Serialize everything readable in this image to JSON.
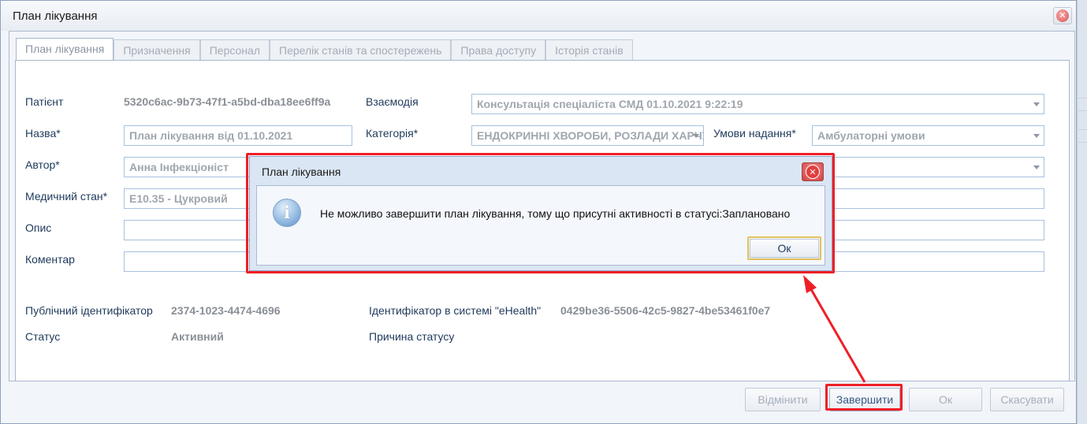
{
  "window": {
    "title": "План лікування"
  },
  "tabs": [
    {
      "label": "План лікування",
      "active": true
    },
    {
      "label": "Призначення",
      "active": false
    },
    {
      "label": "Персонал",
      "active": false
    },
    {
      "label": "Перелік станів та спостережень",
      "active": false
    },
    {
      "label": "Права доступу",
      "active": false
    },
    {
      "label": "Історія станів",
      "active": false
    }
  ],
  "form": {
    "patient_label": "Патієнт",
    "patient_value": "5320c6ac-9b73-47f1-a5bd-dba18ee6ff9a",
    "interaction_label": "Взаємодія",
    "interaction_value": "Консультація спеціаліста СМД 01.10.2021 9:22:19",
    "name_label": "Назва*",
    "name_value": "План лікування від 01.10.2021",
    "category_label": "Категорія*",
    "category_value": "ЕНДОКРИННІ ХВОРОБИ, РОЗЛАДИ ХАРЧУВАННЯ",
    "conditions_label": "Умови надання*",
    "conditions_value": "Амбулаторні умови",
    "author_label": "Автор*",
    "author_value": "Анна Інфекціоніст",
    "condition_label": "Медичний стан*",
    "condition_value": "E10.35 - Цукровий",
    "description_label": "Опис",
    "description_value": "",
    "comment_label": "Коментар",
    "comment_value": "",
    "public_id_label": "Публічний ідентифікатор",
    "public_id_value": "2374-1023-4474-4696",
    "ehealth_id_label": "Ідентифікатор в системі \"eHealth\"",
    "ehealth_id_value": "0429be36-5506-42c5-9827-4be53461f0e7",
    "status_label": "Статус",
    "status_value": "Активний",
    "status_reason_label": "Причина статусу",
    "status_reason_value": ""
  },
  "buttons": {
    "cancel_plan": "Відмінити",
    "complete": "Завершити",
    "ok": "Ок",
    "discard": "Скасувати"
  },
  "dialog": {
    "title": "План лікування",
    "message": "Не можливо завершити план лікування, тому що присутні активності в статусі:Заплановано",
    "ok_label": "Ок",
    "icon": "info-icon"
  },
  "colors": {
    "annotation": "#ee1f26",
    "label": "#1e395b",
    "readonly_value": "#8a8f96"
  }
}
